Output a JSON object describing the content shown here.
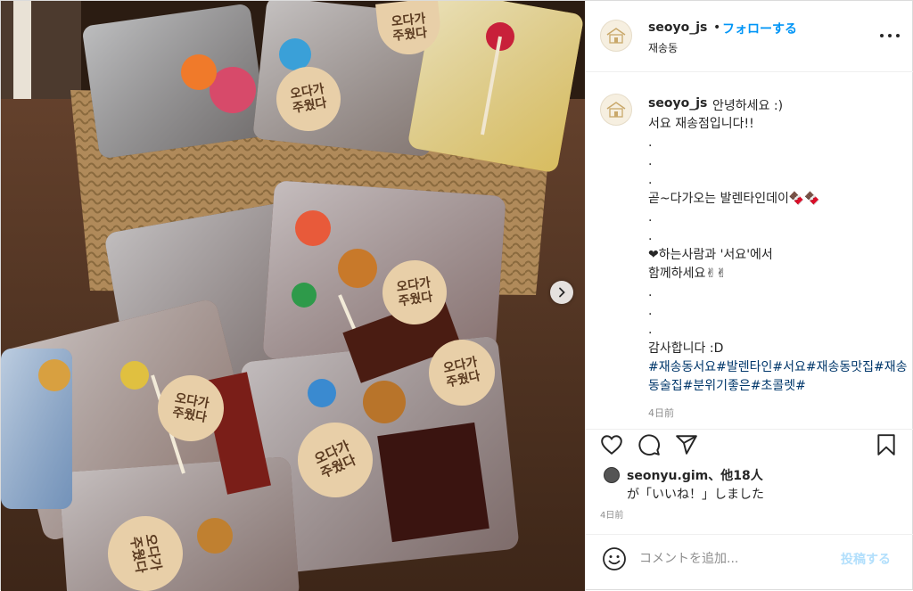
{
  "header": {
    "username": "seoyo_js",
    "separator": "•",
    "follow_label": "フォローする",
    "location": "재송동",
    "more_icon": "more-horizontal-icon"
  },
  "caption": {
    "username": "seoyo_js",
    "first_line": "안녕하세요 :)",
    "lines": [
      "서요 재송점입니다!!",
      ".",
      ".",
      ".",
      "곧~다가오는 발렌타인데이🍫🍫",
      ".",
      ".",
      "❤하는사람과 '서요'에서",
      "함께하세요✌✌",
      ".",
      ".",
      ".",
      "감사합니다 :D"
    ],
    "hashtags": "#재송동서요#발렌타인#서요#재송동맛집#재송동술집#분위기좋은#초콜렛#",
    "time": "4日前"
  },
  "actions": {
    "like_icon": "heart-icon",
    "comment_icon": "comment-icon",
    "share_icon": "share-icon",
    "save_icon": "bookmark-icon"
  },
  "likes": {
    "liker": "seonyu.gim",
    "others": "、他18人",
    "suffix": "が「いいね！」しました",
    "time": "4日前"
  },
  "comment": {
    "placeholder": "コメントを追加...",
    "post_label": "投稿する",
    "emoji_icon": "smile-icon"
  },
  "media": {
    "sticker_text": [
      "오다가",
      "주웠다"
    ],
    "next_icon": "chevron-right-icon"
  },
  "colors": {
    "accent": "#0095f6",
    "hashtag": "#00376b",
    "muted": "#8e8e8e",
    "post_disabled": "#b2dffc"
  }
}
